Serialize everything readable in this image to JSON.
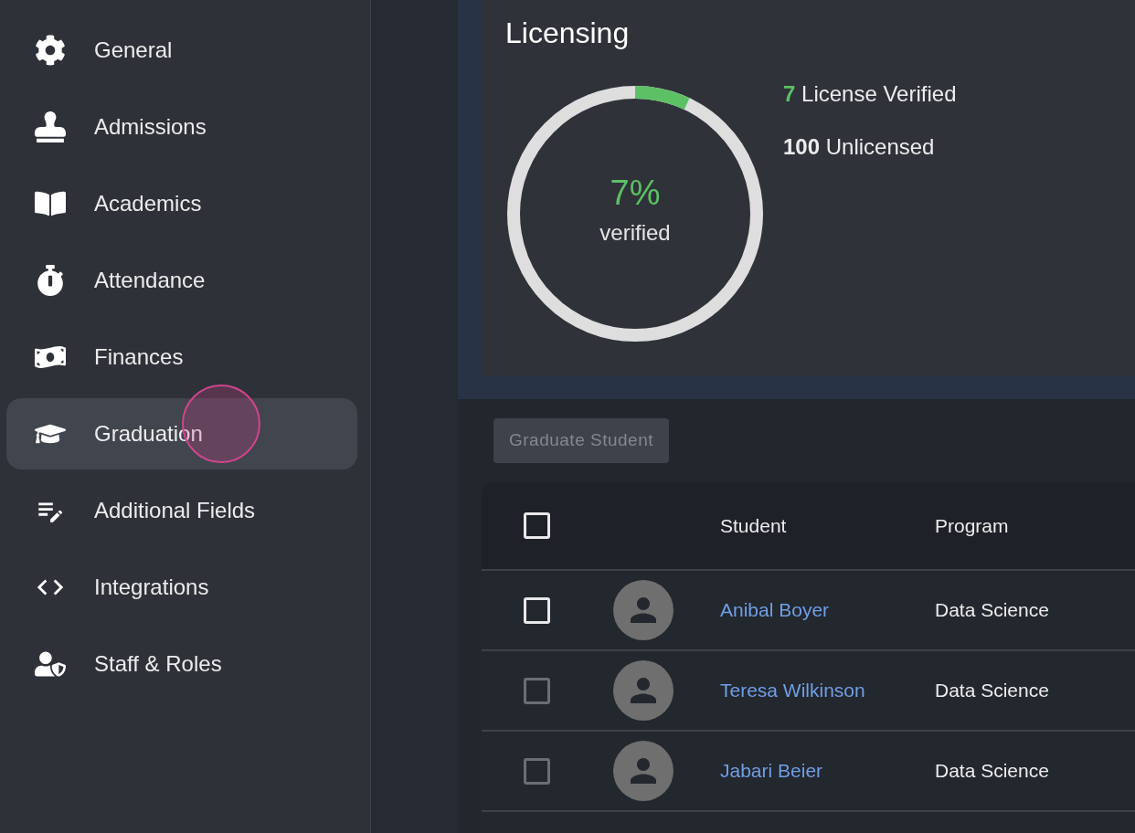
{
  "sidebar": {
    "items": [
      {
        "label": "General",
        "selected": false
      },
      {
        "label": "Admissions",
        "selected": false
      },
      {
        "label": "Academics",
        "selected": false
      },
      {
        "label": "Attendance",
        "selected": false
      },
      {
        "label": "Finances",
        "selected": false
      },
      {
        "label": "Graduation",
        "selected": true
      },
      {
        "label": "Additional Fields",
        "selected": false
      },
      {
        "label": "Integrations",
        "selected": false
      },
      {
        "label": "Staff & Roles",
        "selected": false
      }
    ]
  },
  "licensing": {
    "title": "Licensing",
    "percent": "7%",
    "caption": "verified",
    "level": 0.07,
    "stats": [
      {
        "count": "7",
        "label": "License Verified",
        "kind": "verified"
      },
      {
        "count": "100",
        "label": "Unlicensed",
        "kind": "unlicensed"
      }
    ]
  },
  "graduate_button": {
    "label": "Graduate Student",
    "disabled": true
  },
  "table": {
    "header_checkbox": {
      "checked": false,
      "disabled": false
    },
    "columns": [
      "Student",
      "Program"
    ],
    "rows": [
      {
        "student": "Anibal Boyer",
        "program": "Data Science",
        "checked": false,
        "disabled": false
      },
      {
        "student": "Teresa Wilkinson",
        "program": "Data Science",
        "checked": false,
        "disabled": true
      },
      {
        "student": "Jabari Beier",
        "program": "Data Science",
        "checked": false,
        "disabled": true
      }
    ]
  }
}
